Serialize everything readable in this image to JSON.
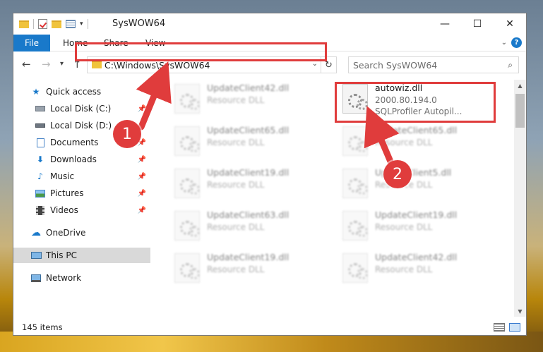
{
  "window": {
    "title": "SysWOW64",
    "controls": {
      "minimize": "—",
      "maximize": "☐",
      "close": "✕"
    }
  },
  "ribbon": {
    "tabs": [
      "File",
      "Home",
      "Share",
      "View"
    ]
  },
  "nav": {
    "address": "C:\\Windows\\SysWOW64",
    "search_placeholder": "Search SysWOW64"
  },
  "sidebar": {
    "items": [
      {
        "label": "Quick access",
        "icon": "star-icon"
      },
      {
        "label": "Local Disk (C:)",
        "icon": "drive-icon"
      },
      {
        "label": "Local Disk (D:)",
        "icon": "drive-icon"
      },
      {
        "label": "Documents",
        "icon": "documents-icon"
      },
      {
        "label": "Downloads",
        "icon": "download-icon"
      },
      {
        "label": "Music",
        "icon": "music-icon"
      },
      {
        "label": "Pictures",
        "icon": "pictures-icon"
      },
      {
        "label": "Videos",
        "icon": "videos-icon"
      },
      {
        "label": "OneDrive",
        "icon": "cloud-icon"
      },
      {
        "label": "This PC",
        "icon": "computer-icon",
        "selected": true
      },
      {
        "label": "Network",
        "icon": "network-icon"
      }
    ]
  },
  "files": [
    {
      "name": "UpdateClient42.dll",
      "line1": "Resource DLL"
    },
    {
      "name": "autowiz.dll",
      "line1": "2000.80.194.0",
      "line2": "SQLProfiler Autopil..."
    },
    {
      "name": "UpdateClient65.dll",
      "line1": "Resource DLL"
    },
    {
      "name": "UpdateClient65.dll",
      "line1": "Resource DLL"
    },
    {
      "name": "UpdateClient19.dll",
      "line1": "Resource DLL"
    },
    {
      "name": "UpdateClient5.dll",
      "line1": "Resource DLL"
    },
    {
      "name": "UpdateClient63.dll",
      "line1": "Resource DLL"
    },
    {
      "name": "UpdateClient19.dll",
      "line1": "Resource DLL"
    },
    {
      "name": "UpdateClient19.dll",
      "line1": "Resource DLL"
    },
    {
      "name": "UpdateClient42.dll",
      "line1": "Resource DLL"
    }
  ],
  "status": {
    "count": "145 items"
  },
  "callouts": {
    "one": "1",
    "two": "2"
  },
  "colors": {
    "accent": "#1979ca",
    "highlight": "#e03c3c",
    "selected": "#d9d9d9"
  }
}
